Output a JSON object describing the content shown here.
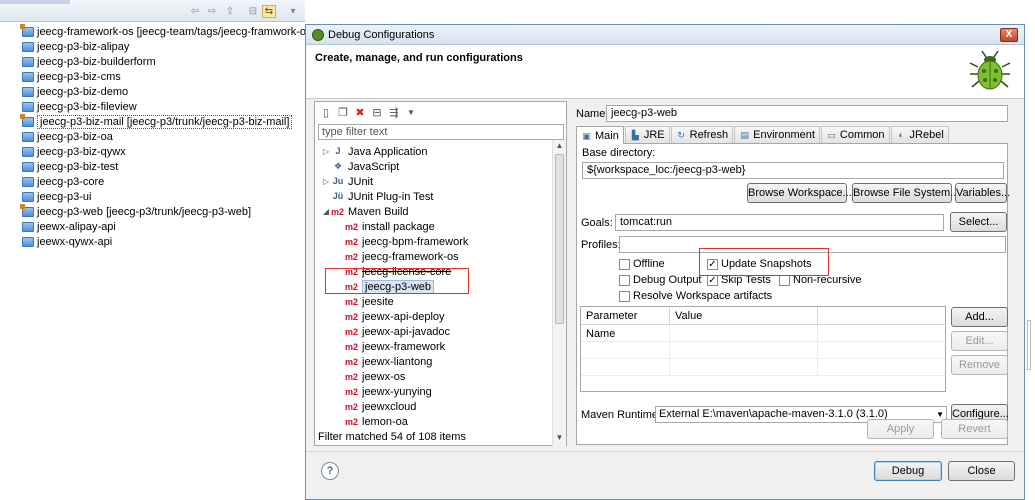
{
  "explorer": {
    "projects": [
      {
        "label": "jeecg-framework-os [jeecg-team/tags/jeecg-framwork-os]",
        "svn": true
      },
      {
        "label": "jeecg-p3-biz-alipay",
        "svn": false
      },
      {
        "label": "jeecg-p3-biz-builderform",
        "svn": false
      },
      {
        "label": "jeecg-p3-biz-cms",
        "svn": false
      },
      {
        "label": "jeecg-p3-biz-demo",
        "svn": false
      },
      {
        "label": "jeecg-p3-biz-fileview",
        "svn": false
      },
      {
        "label": "jeecg-p3-biz-mail [jeecg-p3/trunk/jeecg-p3-biz-mail]",
        "svn": true
      },
      {
        "label": "jeecg-p3-biz-oa",
        "svn": false
      },
      {
        "label": "jeecg-p3-biz-qywx",
        "svn": false
      },
      {
        "label": "jeecg-p3-biz-test",
        "svn": false
      },
      {
        "label": "jeecg-p3-core",
        "svn": false
      },
      {
        "label": "jeecg-p3-ui",
        "svn": false
      },
      {
        "label": "jeecg-p3-web [jeecg-p3/trunk/jeecg-p3-web]",
        "svn": true
      },
      {
        "label": "jeewx-alipay-api",
        "svn": false
      },
      {
        "label": "jeewx-qywx-api",
        "svn": false
      }
    ]
  },
  "dialog": {
    "title": "Debug Configurations",
    "close_glyph": "X",
    "header": "Create, manage, and run configurations",
    "filter_placeholder": "type filter text",
    "tree": [
      {
        "label": "Java Application",
        "level": 0,
        "arrow": "▷",
        "icon": "J"
      },
      {
        "label": "JavaScript",
        "level": 0,
        "arrow": "",
        "icon": "❖"
      },
      {
        "label": "JUnit",
        "level": 0,
        "arrow": "▷",
        "icon": "Ju"
      },
      {
        "label": "JUnit Plug-in Test",
        "level": 0,
        "arrow": "",
        "icon": "Jü"
      },
      {
        "label": "Maven Build",
        "level": 0,
        "arrow": "◢",
        "icon": "m2"
      },
      {
        "label": "install package",
        "level": 1,
        "icon": "m2"
      },
      {
        "label": "jeecg-bpm-framework",
        "level": 1,
        "icon": "m2"
      },
      {
        "label": "jeecg-framework-os",
        "level": 1,
        "icon": "m2"
      },
      {
        "label": "jeecg-license-core",
        "level": 1,
        "icon": "m2"
      },
      {
        "label": "jeecg-p3-web",
        "level": 1,
        "icon": "m2",
        "selected": true
      },
      {
        "label": "jeesite",
        "level": 1,
        "icon": "m2"
      },
      {
        "label": "jeewx-api-deploy",
        "level": 1,
        "icon": "m2"
      },
      {
        "label": "jeewx-api-javadoc",
        "level": 1,
        "icon": "m2"
      },
      {
        "label": "jeewx-framework",
        "level": 1,
        "icon": "m2"
      },
      {
        "label": "jeewx-liantong",
        "level": 1,
        "icon": "m2"
      },
      {
        "label": "jeewx-os",
        "level": 1,
        "icon": "m2"
      },
      {
        "label": "jeewx-yunying",
        "level": 1,
        "icon": "m2"
      },
      {
        "label": "jeewxcloud",
        "level": 1,
        "icon": "m2"
      },
      {
        "label": "lemon-oa",
        "level": 1,
        "icon": "m2"
      }
    ],
    "filter_status": "Filter matched 54 of 108 items",
    "name_label": "Name:",
    "name_value": "jeecg-p3-web",
    "tabs": [
      {
        "label": "Main",
        "icon": "▣"
      },
      {
        "label": "JRE",
        "icon": "▙"
      },
      {
        "label": "Refresh",
        "icon": "↻"
      },
      {
        "label": "Environment",
        "icon": "▤"
      },
      {
        "label": "Common",
        "icon": "▭"
      },
      {
        "label": "JRebel",
        "icon": "◐"
      }
    ],
    "base_dir_label": "Base directory:",
    "base_dir_value": "${workspace_loc:/jeecg-p3-web}",
    "browse_workspace": "Browse Workspace...",
    "browse_fs": "Browse File System...",
    "variables": "Variables...",
    "goals_label": "Goals:",
    "goals_value": "tomcat:run",
    "select_btn": "Select...",
    "profiles_label": "Profiles:",
    "profiles_value": "",
    "checks": {
      "offline": {
        "label": "Offline",
        "checked": false
      },
      "update_snapshots": {
        "label": "Update Snapshots",
        "checked": true
      },
      "debug_output": {
        "label": "Debug Output",
        "checked": false
      },
      "skip_tests": {
        "label": "Skip Tests",
        "checked": true
      },
      "non_recursive": {
        "label": "Non-recursive",
        "checked": false
      },
      "resolve_ws": {
        "label": "Resolve Workspace artifacts",
        "checked": false
      }
    },
    "param_headers": [
      "Parameter Name",
      "Value"
    ],
    "add_btn": "Add...",
    "edit_btn": "Edit...",
    "remove_btn": "Remove",
    "runtime_label": "Maven Runtime:",
    "runtime_value": "External E:\\maven\\apache-maven-3.1.0 (3.1.0)",
    "configure_btn": "Configure...",
    "apply_btn": "Apply",
    "revert_btn": "Revert",
    "debug_btn": "Debug",
    "close_btn": "Close",
    "help_glyph": "?"
  },
  "colors": {
    "annotation_red": "#e0322a",
    "maven_red": "#c8102e"
  }
}
